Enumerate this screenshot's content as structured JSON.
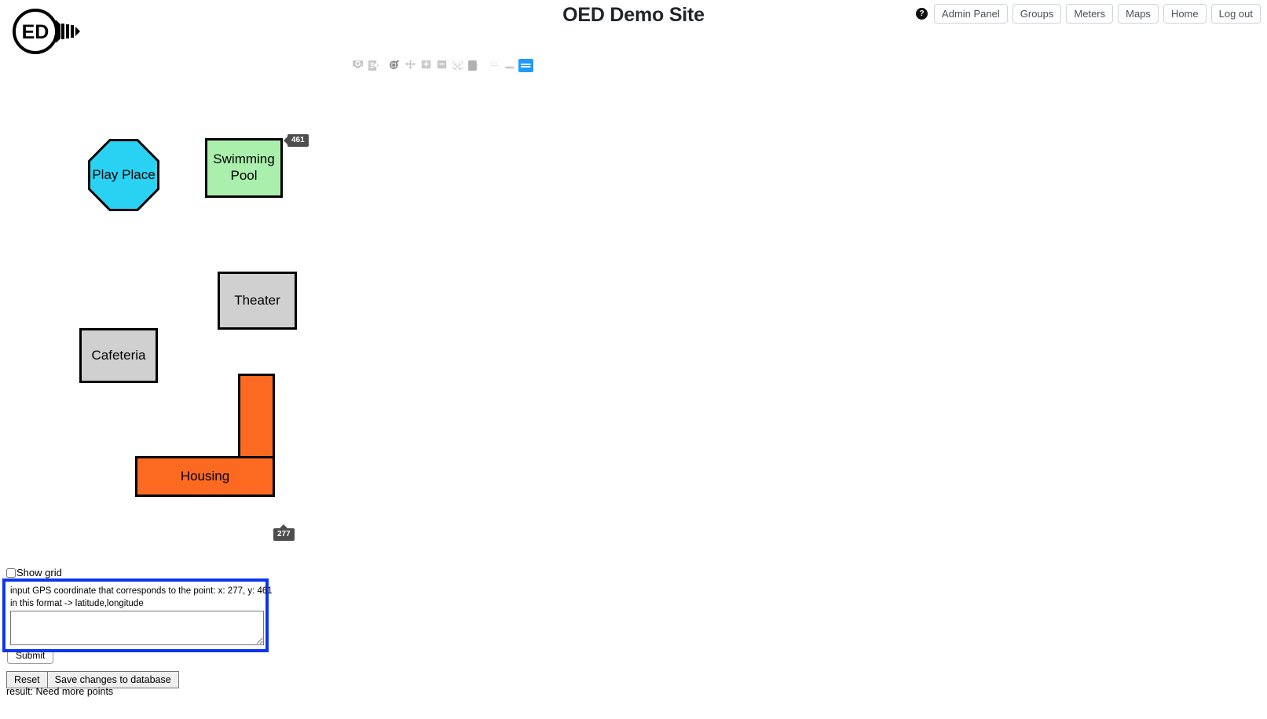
{
  "header": {
    "title": "OED Demo Site",
    "logo_text": "ED",
    "logo_name": "oed-lightbulb-logo",
    "help_icon_label": "?"
  },
  "nav": {
    "items": [
      {
        "label": "Admin Panel",
        "name": "nav-admin-panel"
      },
      {
        "label": "Groups",
        "name": "nav-groups"
      },
      {
        "label": "Meters",
        "name": "nav-meters"
      },
      {
        "label": "Maps",
        "name": "nav-maps"
      },
      {
        "label": "Home",
        "name": "nav-home"
      },
      {
        "label": "Log out",
        "name": "nav-log-out"
      }
    ]
  },
  "modebar": {
    "buttons": [
      {
        "name": "download-plot-as-png-icon",
        "title": "Download plot as a png",
        "active": false
      },
      {
        "name": "edit-in-chart-studio-icon",
        "title": "Edit in Chart Studio",
        "active": false
      },
      {
        "name": "zoom-icon",
        "title": "Zoom",
        "active": false
      },
      {
        "name": "pan-icon",
        "title": "Pan",
        "active": false
      },
      {
        "name": "zoom-in-icon",
        "title": "Zoom in",
        "active": false
      },
      {
        "name": "zoom-out-icon",
        "title": "Zoom out",
        "active": false
      },
      {
        "name": "autoscale-icon",
        "title": "Autoscale",
        "active": false
      },
      {
        "name": "reset-axes-home-icon",
        "title": "Reset axes",
        "active": false
      },
      {
        "name": "toggle-spike-lines-icon",
        "title": "Toggle Spike Lines",
        "active": false
      },
      {
        "name": "show-closest-data-icon",
        "title": "Show closest data on hover",
        "active": false
      },
      {
        "name": "compare-data-on-hover-icon",
        "title": "Compare data on hover",
        "active": true
      }
    ]
  },
  "map": {
    "shapes": [
      {
        "id": "play-place",
        "label": "Play Place",
        "color": "#29d2f2",
        "shape": "octagon"
      },
      {
        "id": "swimming-pool",
        "label": "Swimming Pool",
        "color": "#aaf0ac",
        "shape": "rectangle"
      },
      {
        "id": "theater",
        "label": "Theater",
        "color": "#d0d0d0",
        "shape": "rectangle"
      },
      {
        "id": "cafeteria",
        "label": "Cafeteria",
        "color": "#d0d0d0",
        "shape": "rectangle"
      },
      {
        "id": "housing",
        "label": "Housing",
        "color": "#fc6a21",
        "shape": "l-shape"
      }
    ],
    "tooltips": {
      "y_value": "461",
      "x_value": "277"
    }
  },
  "controls": {
    "show_grid_label": "Show grid",
    "show_grid_checked": false,
    "gps_prompt_line1": "input GPS coordinate that corresponds to the point: x: 277, y: 461",
    "gps_prompt_line2": "in this format -> latitude,longitude",
    "gps_input_value": "",
    "gps_input_placeholder": "",
    "submit_label": "Submit",
    "reset_label": "Reset",
    "save_label": "Save changes to database",
    "result_text": "result: Need more points"
  },
  "colors": {
    "highlight_border": "#0b35f0",
    "modebar_active": "#1f9bff",
    "tooltip_bg": "#4d4d4d"
  }
}
